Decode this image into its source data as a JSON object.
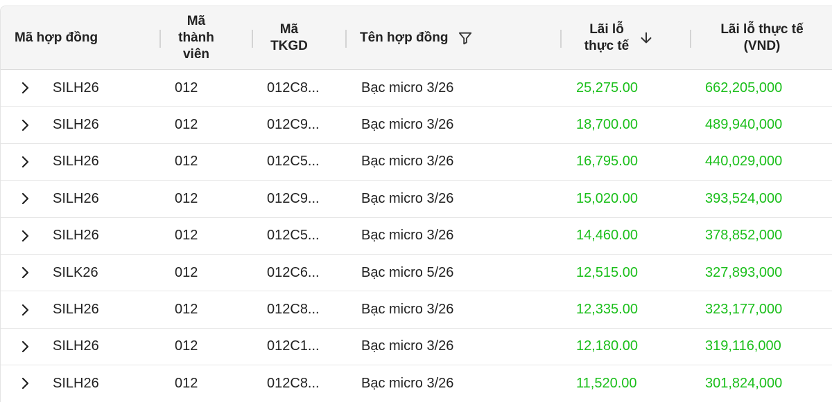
{
  "colors": {
    "header_bg": "#f5f5f5",
    "profit_green": "#1bbf1b",
    "text_dark": "#222222"
  },
  "header": {
    "contract_code": "Mã hợp đồng",
    "member_code": "Mã\nthành\nviên",
    "account_code": "Mã\nTKGD",
    "contract_name": "Tên hợp đồng",
    "filter_icon": "filter-icon",
    "realized_pnl": "Lãi lỗ\nthực tế",
    "sort_icon": "arrow-down-icon",
    "realized_pnl_vnd": "Lãi lỗ thực tế\n(VND)"
  },
  "rows": [
    {
      "code": "SILH26",
      "member": "012",
      "account": "012C8...",
      "name": "Bạc micro 3/26",
      "pnl": "25,275.00",
      "pnl_vnd": "662,205,000"
    },
    {
      "code": "SILH26",
      "member": "012",
      "account": "012C9...",
      "name": "Bạc micro 3/26",
      "pnl": "18,700.00",
      "pnl_vnd": "489,940,000"
    },
    {
      "code": "SILH26",
      "member": "012",
      "account": "012C5...",
      "name": "Bạc micro 3/26",
      "pnl": "16,795.00",
      "pnl_vnd": "440,029,000"
    },
    {
      "code": "SILH26",
      "member": "012",
      "account": "012C9...",
      "name": "Bạc micro 3/26",
      "pnl": "15,020.00",
      "pnl_vnd": "393,524,000"
    },
    {
      "code": "SILH26",
      "member": "012",
      "account": "012C5...",
      "name": "Bạc micro 3/26",
      "pnl": "14,460.00",
      "pnl_vnd": "378,852,000"
    },
    {
      "code": "SILK26",
      "member": "012",
      "account": "012C6...",
      "name": "Bạc micro 5/26",
      "pnl": "12,515.00",
      "pnl_vnd": "327,893,000"
    },
    {
      "code": "SILH26",
      "member": "012",
      "account": "012C8...",
      "name": "Bạc micro 3/26",
      "pnl": "12,335.00",
      "pnl_vnd": "323,177,000"
    },
    {
      "code": "SILH26",
      "member": "012",
      "account": "012C1...",
      "name": "Bạc micro 3/26",
      "pnl": "12,180.00",
      "pnl_vnd": "319,116,000"
    },
    {
      "code": "SILH26",
      "member": "012",
      "account": "012C8...",
      "name": "Bạc micro 3/26",
      "pnl": "11,520.00",
      "pnl_vnd": "301,824,000"
    }
  ]
}
